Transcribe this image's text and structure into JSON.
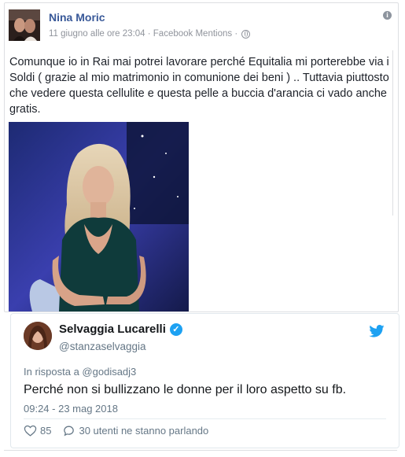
{
  "facebook_post": {
    "author": "Nina Moric",
    "meta": "11 giugno alle ore 23:04 · Facebook Mentions ·",
    "text": "Comunque io in Rai mai potrei lavorare perché Equitalia mi porterebbe via i Soldi ( grazie al mio matrimonio in comunione dei beni ) .. Tuttavia piuttosto che vedere questa cellulite e questa pelle a buccia d'arancia ci vado anche gratis.",
    "info_icon": "info-icon",
    "privacy_icon": "globe-icon"
  },
  "tweet": {
    "display_name": "Selvaggia Lucarelli",
    "handle": "@stanzaselvaggia",
    "in_reply_to": "In risposta a @godisadj3",
    "text": "Perché non si bullizzano le donne per il loro aspetto su fb.",
    "timestamp": "09:24 - 23 mag 2018",
    "likes": "85",
    "replies_label": "30 utenti ne stanno parlando"
  },
  "colors": {
    "facebook_link": "#385898",
    "twitter_blue": "#1da1f2",
    "muted": "#657786"
  }
}
